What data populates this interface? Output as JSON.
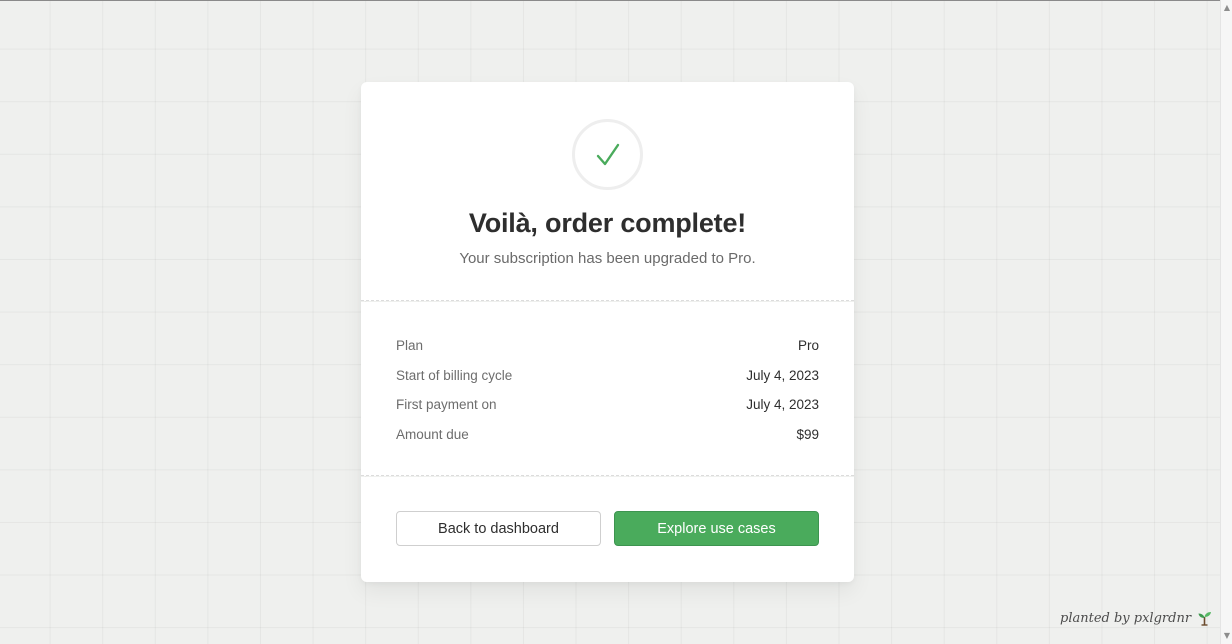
{
  "order": {
    "title": "Voilà, order complete!",
    "subtitle": "Your subscription has been upgraded to Pro."
  },
  "details": [
    {
      "label": "Plan",
      "value": "Pro"
    },
    {
      "label": "Start of billing cycle",
      "value": "July 4, 2023"
    },
    {
      "label": "First payment on",
      "value": "July 4, 2023"
    },
    {
      "label": "Amount due",
      "value": "$99"
    }
  ],
  "actions": {
    "back_label": "Back to dashboard",
    "explore_label": "Explore use cases"
  },
  "footer": {
    "credit": "planted by pxlgrdnr",
    "icon": "sprout-icon"
  },
  "colors": {
    "accent": "#4aab5c",
    "background": "#eff0ee"
  }
}
